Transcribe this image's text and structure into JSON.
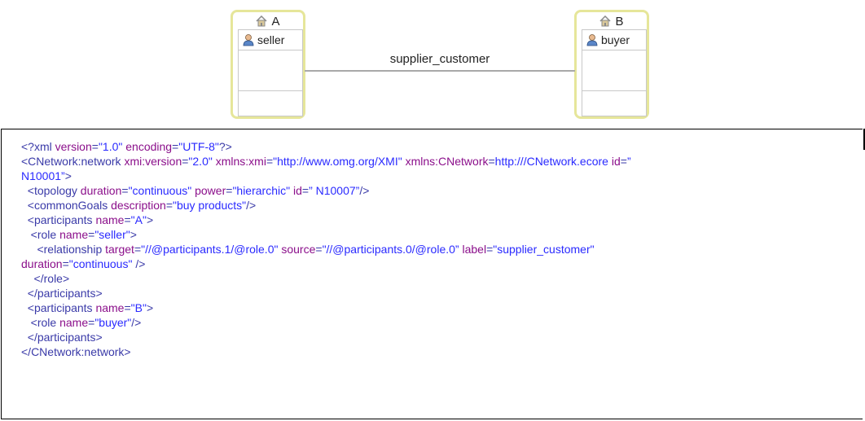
{
  "diagram": {
    "participants": [
      {
        "name": "A",
        "icon": "house-icon",
        "role": {
          "name": "seller",
          "icon": "user-icon"
        }
      },
      {
        "name": "B",
        "icon": "house-icon",
        "role": {
          "name": "buyer",
          "icon": "user-icon"
        }
      }
    ],
    "relationship_label": "supplier_customer"
  },
  "xml_lines": [
    [
      [
        "t",
        "<?xml "
      ],
      [
        "a",
        "version"
      ],
      [
        "t",
        "="
      ],
      [
        "v",
        "\"1.0\""
      ],
      [
        "t",
        " "
      ],
      [
        "a",
        "encoding"
      ],
      [
        "t",
        "="
      ],
      [
        "v",
        "\"UTF-8\""
      ],
      [
        "t",
        "?>"
      ]
    ],
    [
      [
        "t",
        "<CNetwork:network "
      ],
      [
        "a",
        "xmi:version"
      ],
      [
        "t",
        "="
      ],
      [
        "v",
        "\"2.0\""
      ],
      [
        "t",
        " "
      ],
      [
        "a",
        "xmlns:xmi"
      ],
      [
        "t",
        "="
      ],
      [
        "v",
        "\"http://www.omg.org/XMI\""
      ],
      [
        "t",
        " "
      ],
      [
        "a",
        "xmlns:CNetwork"
      ],
      [
        "t",
        "="
      ],
      [
        "v",
        "http:///CNetwork.ecore"
      ],
      [
        "t",
        " "
      ],
      [
        "a",
        "id"
      ],
      [
        "t",
        "="
      ],
      [
        "v",
        "”"
      ]
    ],
    [
      [
        "v",
        "N10001”"
      ],
      [
        "t",
        ">"
      ]
    ],
    [
      [
        "t",
        "  <topology "
      ],
      [
        "a",
        "duration"
      ],
      [
        "t",
        "="
      ],
      [
        "v",
        "\"continuous\""
      ],
      [
        "t",
        " "
      ],
      [
        "a",
        "power"
      ],
      [
        "t",
        "="
      ],
      [
        "v",
        "\"hierarchic\""
      ],
      [
        "t",
        " "
      ],
      [
        "a",
        "id"
      ],
      [
        "t",
        "="
      ],
      [
        "v",
        "” N10007”"
      ],
      [
        "t",
        "/>"
      ]
    ],
    [
      [
        "t",
        "  <commonGoals "
      ],
      [
        "a",
        "description"
      ],
      [
        "t",
        "="
      ],
      [
        "v",
        "\"buy products\""
      ],
      [
        "t",
        "/>"
      ]
    ],
    [
      [
        "t",
        "  <participants "
      ],
      [
        "a",
        "name"
      ],
      [
        "t",
        "="
      ],
      [
        "v",
        "\"A\""
      ],
      [
        "t",
        ">"
      ]
    ],
    [
      [
        "t",
        "   <role "
      ],
      [
        "a",
        "name"
      ],
      [
        "t",
        "="
      ],
      [
        "v",
        "\"seller\""
      ],
      [
        "t",
        ">"
      ]
    ],
    [
      [
        "t",
        "     <relationship "
      ],
      [
        "a",
        "target"
      ],
      [
        "t",
        "="
      ],
      [
        "v",
        "\"//@participants.1/@role.0\""
      ],
      [
        "t",
        " "
      ],
      [
        "a",
        "source"
      ],
      [
        "t",
        "="
      ],
      [
        "v",
        "\"//@participants.0/@role.0”"
      ],
      [
        "t",
        " "
      ],
      [
        "a",
        "label"
      ],
      [
        "t",
        "="
      ],
      [
        "v",
        "\"supplier_customer\""
      ]
    ],
    [
      [
        "a",
        "duration"
      ],
      [
        "t",
        "="
      ],
      [
        "v",
        "\"continuous\""
      ],
      [
        "t",
        " />"
      ]
    ],
    [
      [
        "t",
        "    </role>"
      ]
    ],
    [
      [
        "t",
        "  </participants>"
      ]
    ],
    [
      [
        "t",
        "  <participants "
      ],
      [
        "a",
        "name"
      ],
      [
        "t",
        "="
      ],
      [
        "v",
        "\"B\""
      ],
      [
        "t",
        ">"
      ]
    ],
    [
      [
        "t",
        "   <role "
      ],
      [
        "a",
        "name"
      ],
      [
        "t",
        "="
      ],
      [
        "v",
        "\"buyer\""
      ],
      [
        "t",
        "/>"
      ]
    ],
    [
      [
        "t",
        "  </participants>"
      ]
    ],
    [
      [
        "t",
        "</CNetwork:network>"
      ]
    ]
  ]
}
